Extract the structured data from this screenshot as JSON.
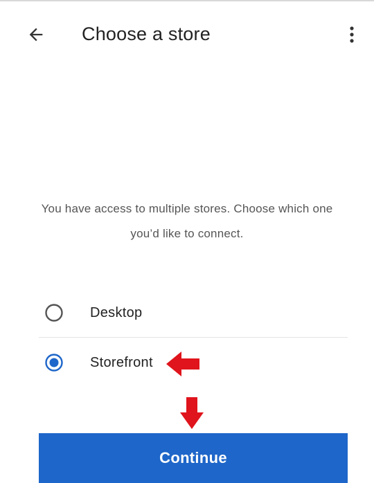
{
  "header": {
    "title": "Choose a store",
    "back_icon": "arrow-back-icon",
    "menu_icon": "more-vertical-icon"
  },
  "message": "You have access to multiple stores. Choose which one you’d like to connect.",
  "options": [
    {
      "label": "Desktop",
      "selected": false
    },
    {
      "label": "Storefront",
      "selected": true
    }
  ],
  "continue_label": "Continue",
  "colors": {
    "accent": "#1e66c9",
    "annotation_arrow": "#e0141c"
  }
}
